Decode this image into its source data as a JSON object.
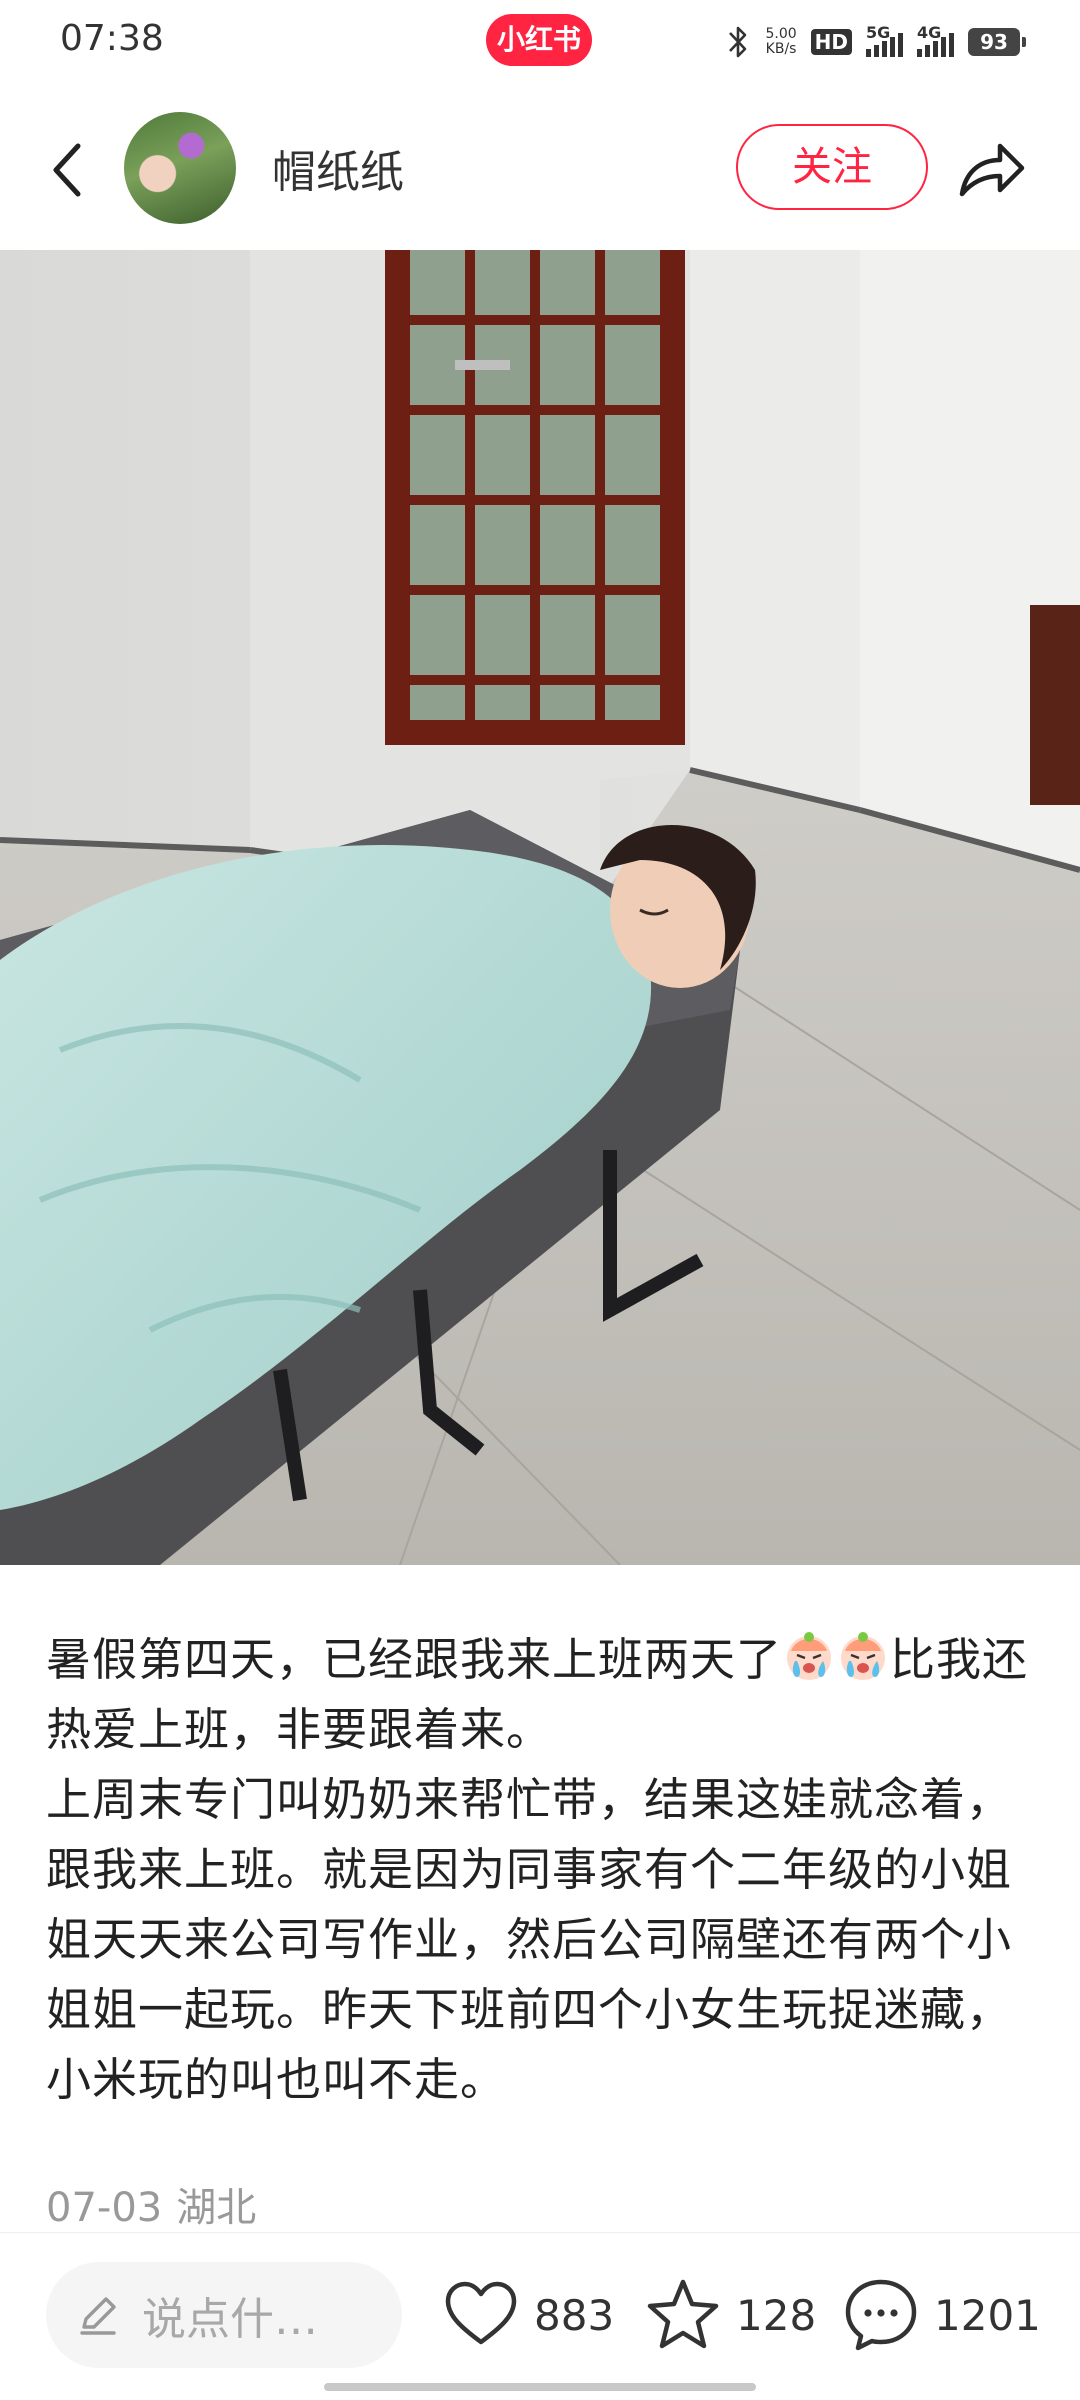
{
  "status_bar": {
    "time": "07:38",
    "app_badge": "小红书",
    "net_speed_value": "5.00",
    "net_speed_unit": "KB/s",
    "hd_label": "HD",
    "sim1_label": "5G",
    "sim2_label": "4G",
    "battery": "93"
  },
  "header": {
    "author_name": "帽纸纸",
    "follow_label": "关注"
  },
  "note": {
    "line1_a": "暑假第四天，已经跟我来上班两天了",
    "line1_b": "比我还热爱上班，非要跟着来。",
    "paragraph2": "上周末专门叫奶奶来帮忙带，结果这娃就念着，跟我来上班。就是因为同事家有个二年级的小姐姐天天来公司写作业，然后公司隔壁还有两个小姐姐一起玩。昨天下班前四个小女生玩捉迷藏，小米玩的叫也叫不走。",
    "date": "07-03",
    "location": "湖北"
  },
  "bottom_bar": {
    "comment_placeholder": "说点什…",
    "like_count": "883",
    "collect_count": "128",
    "comment_count": "1201"
  },
  "icons": {
    "back": "chevron-left-icon",
    "share": "share-arrow-icon",
    "like": "heart-icon",
    "collect": "star-icon",
    "comment": "chat-bubble-icon",
    "edit": "pencil-icon",
    "emoji": "crying-face-emoji"
  },
  "colors": {
    "brand": "#ff2442",
    "text": "#222222",
    "meta": "#999999"
  }
}
